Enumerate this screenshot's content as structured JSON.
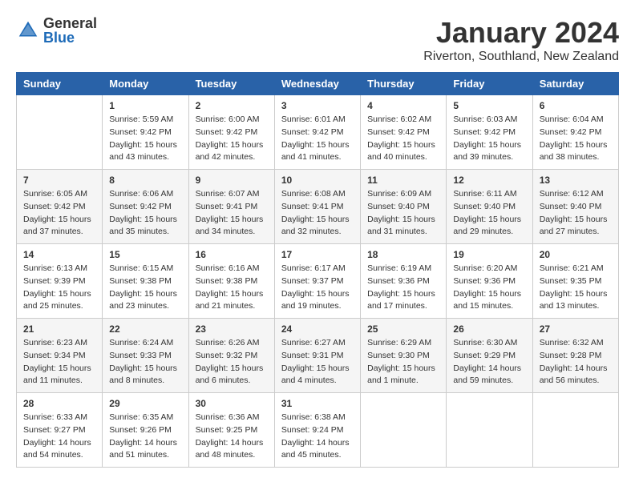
{
  "logo": {
    "general": "General",
    "blue": "Blue"
  },
  "title": "January 2024",
  "location": "Riverton, Southland, New Zealand",
  "days_of_week": [
    "Sunday",
    "Monday",
    "Tuesday",
    "Wednesday",
    "Thursday",
    "Friday",
    "Saturday"
  ],
  "weeks": [
    [
      {
        "day": "",
        "info": ""
      },
      {
        "day": "1",
        "info": "Sunrise: 5:59 AM\nSunset: 9:42 PM\nDaylight: 15 hours\nand 43 minutes."
      },
      {
        "day": "2",
        "info": "Sunrise: 6:00 AM\nSunset: 9:42 PM\nDaylight: 15 hours\nand 42 minutes."
      },
      {
        "day": "3",
        "info": "Sunrise: 6:01 AM\nSunset: 9:42 PM\nDaylight: 15 hours\nand 41 minutes."
      },
      {
        "day": "4",
        "info": "Sunrise: 6:02 AM\nSunset: 9:42 PM\nDaylight: 15 hours\nand 40 minutes."
      },
      {
        "day": "5",
        "info": "Sunrise: 6:03 AM\nSunset: 9:42 PM\nDaylight: 15 hours\nand 39 minutes."
      },
      {
        "day": "6",
        "info": "Sunrise: 6:04 AM\nSunset: 9:42 PM\nDaylight: 15 hours\nand 38 minutes."
      }
    ],
    [
      {
        "day": "7",
        "info": "Sunrise: 6:05 AM\nSunset: 9:42 PM\nDaylight: 15 hours\nand 37 minutes."
      },
      {
        "day": "8",
        "info": "Sunrise: 6:06 AM\nSunset: 9:42 PM\nDaylight: 15 hours\nand 35 minutes."
      },
      {
        "day": "9",
        "info": "Sunrise: 6:07 AM\nSunset: 9:41 PM\nDaylight: 15 hours\nand 34 minutes."
      },
      {
        "day": "10",
        "info": "Sunrise: 6:08 AM\nSunset: 9:41 PM\nDaylight: 15 hours\nand 32 minutes."
      },
      {
        "day": "11",
        "info": "Sunrise: 6:09 AM\nSunset: 9:40 PM\nDaylight: 15 hours\nand 31 minutes."
      },
      {
        "day": "12",
        "info": "Sunrise: 6:11 AM\nSunset: 9:40 PM\nDaylight: 15 hours\nand 29 minutes."
      },
      {
        "day": "13",
        "info": "Sunrise: 6:12 AM\nSunset: 9:40 PM\nDaylight: 15 hours\nand 27 minutes."
      }
    ],
    [
      {
        "day": "14",
        "info": "Sunrise: 6:13 AM\nSunset: 9:39 PM\nDaylight: 15 hours\nand 25 minutes."
      },
      {
        "day": "15",
        "info": "Sunrise: 6:15 AM\nSunset: 9:38 PM\nDaylight: 15 hours\nand 23 minutes."
      },
      {
        "day": "16",
        "info": "Sunrise: 6:16 AM\nSunset: 9:38 PM\nDaylight: 15 hours\nand 21 minutes."
      },
      {
        "day": "17",
        "info": "Sunrise: 6:17 AM\nSunset: 9:37 PM\nDaylight: 15 hours\nand 19 minutes."
      },
      {
        "day": "18",
        "info": "Sunrise: 6:19 AM\nSunset: 9:36 PM\nDaylight: 15 hours\nand 17 minutes."
      },
      {
        "day": "19",
        "info": "Sunrise: 6:20 AM\nSunset: 9:36 PM\nDaylight: 15 hours\nand 15 minutes."
      },
      {
        "day": "20",
        "info": "Sunrise: 6:21 AM\nSunset: 9:35 PM\nDaylight: 15 hours\nand 13 minutes."
      }
    ],
    [
      {
        "day": "21",
        "info": "Sunrise: 6:23 AM\nSunset: 9:34 PM\nDaylight: 15 hours\nand 11 minutes."
      },
      {
        "day": "22",
        "info": "Sunrise: 6:24 AM\nSunset: 9:33 PM\nDaylight: 15 hours\nand 8 minutes."
      },
      {
        "day": "23",
        "info": "Sunrise: 6:26 AM\nSunset: 9:32 PM\nDaylight: 15 hours\nand 6 minutes."
      },
      {
        "day": "24",
        "info": "Sunrise: 6:27 AM\nSunset: 9:31 PM\nDaylight: 15 hours\nand 4 minutes."
      },
      {
        "day": "25",
        "info": "Sunrise: 6:29 AM\nSunset: 9:30 PM\nDaylight: 15 hours\nand 1 minute."
      },
      {
        "day": "26",
        "info": "Sunrise: 6:30 AM\nSunset: 9:29 PM\nDaylight: 14 hours\nand 59 minutes."
      },
      {
        "day": "27",
        "info": "Sunrise: 6:32 AM\nSunset: 9:28 PM\nDaylight: 14 hours\nand 56 minutes."
      }
    ],
    [
      {
        "day": "28",
        "info": "Sunrise: 6:33 AM\nSunset: 9:27 PM\nDaylight: 14 hours\nand 54 minutes."
      },
      {
        "day": "29",
        "info": "Sunrise: 6:35 AM\nSunset: 9:26 PM\nDaylight: 14 hours\nand 51 minutes."
      },
      {
        "day": "30",
        "info": "Sunrise: 6:36 AM\nSunset: 9:25 PM\nDaylight: 14 hours\nand 48 minutes."
      },
      {
        "day": "31",
        "info": "Sunrise: 6:38 AM\nSunset: 9:24 PM\nDaylight: 14 hours\nand 45 minutes."
      },
      {
        "day": "",
        "info": ""
      },
      {
        "day": "",
        "info": ""
      },
      {
        "day": "",
        "info": ""
      }
    ]
  ]
}
